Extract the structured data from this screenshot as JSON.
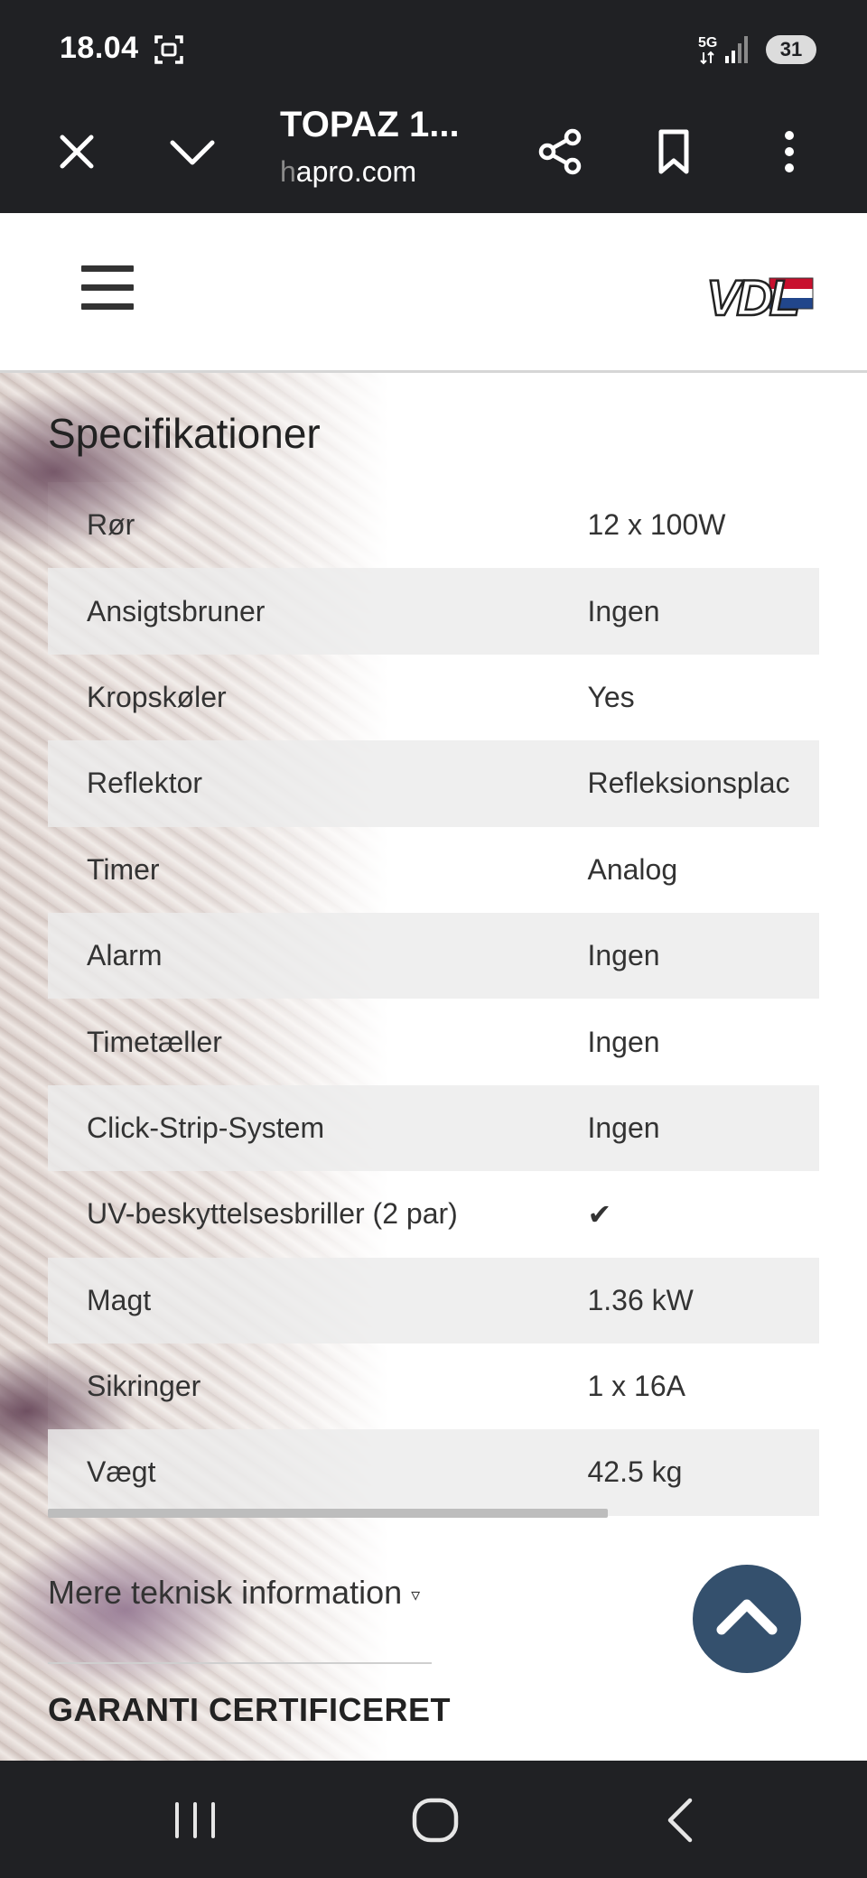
{
  "status_bar": {
    "time": "18.04",
    "network": "5G",
    "battery": "31"
  },
  "browser": {
    "page_title": "TOPAZ 1...",
    "url_dim": "h",
    "url_rest": "apro.com",
    "icons": [
      "close-icon",
      "chevron-down-icon",
      "share-icon",
      "bookmark-icon",
      "more-vert-icon"
    ]
  },
  "site_header": {
    "menu_icon": "hamburger-icon",
    "logo_text": "VDL",
    "logo_flag_colors": [
      "#c8102e",
      "#ffffff",
      "#21468b"
    ]
  },
  "specs": {
    "title": "Specifikationer",
    "rows": [
      {
        "key": "Rør",
        "value": "12 x 100W"
      },
      {
        "key": "Ansigtsbruner",
        "value": "Ingen"
      },
      {
        "key": "Kropskøler",
        "value": "Yes"
      },
      {
        "key": "Reflektor",
        "value": "Refleksionsplac"
      },
      {
        "key": "Timer",
        "value": "Analog"
      },
      {
        "key": "Alarm",
        "value": "Ingen"
      },
      {
        "key": "Timetæller",
        "value": "Ingen"
      },
      {
        "key": "Click-Strip-System",
        "value": "Ingen"
      },
      {
        "key": "UV-beskyttelsesbriller (2 par)",
        "value": "✔"
      },
      {
        "key": "Magt",
        "value": "1.36 kW"
      },
      {
        "key": "Sikringer",
        "value": "1 x 16A"
      },
      {
        "key": "Vægt",
        "value": "42.5 kg"
      }
    ]
  },
  "more_info": {
    "label": "Mere teknisk information",
    "indicator": "▿"
  },
  "section_next": {
    "heading": "GARANTI CERTIFICERET"
  },
  "colors": {
    "system_bar": "#202124",
    "scroll_top_button": "#34506d"
  }
}
